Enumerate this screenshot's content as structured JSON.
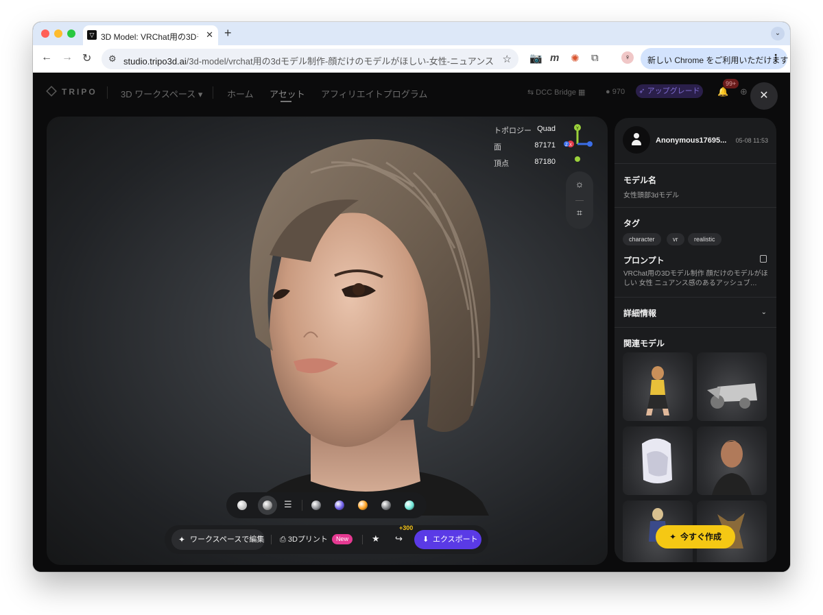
{
  "browser": {
    "tab_title": "3D Model: VRChat用の3Dモデ",
    "url_host": "studio.tripo3d.ai",
    "url_path": "/3d-model/vrchat用の3dモデル制作-顔だけのモデルがほしい-女性-ニュアンス感のあ…",
    "update_text": "新しい Chrome をご利用いただけます",
    "icons": [
      "back-icon",
      "forward-icon",
      "reload-icon",
      "site-settings-icon",
      "star-icon",
      "camera-icon",
      "extension-icon",
      "profile-icon",
      "menu-icon"
    ]
  },
  "nav": {
    "logo": "TRIPO",
    "workspace": "3D ワークスペース",
    "links": [
      "ホーム",
      "アセット",
      "アフィリエイトプログラム"
    ],
    "active_link": "アセット",
    "dcc_bridge": "DCC Bridge",
    "credits": "970",
    "upgrade": "アップグレード",
    "notif_count": "99+"
  },
  "viewer": {
    "stats": [
      {
        "label": "トポロジー",
        "value": "Quad"
      },
      {
        "label": "面",
        "value": "87171"
      },
      {
        "label": "頂点",
        "value": "87180"
      }
    ],
    "gizmo_labels": {
      "y": "Y",
      "x": "X",
      "z": "Z"
    }
  },
  "materials": {
    "colors": [
      "#cfcfcf",
      "#8e9096",
      "#6c5ce7",
      "#ff9f1c",
      "#7d7f83",
      "#6ee7d8"
    ]
  },
  "actions": {
    "edit": "ワークスペースで編集",
    "print": "3Dプリント",
    "new_badge": "New",
    "share_bonus": "+300",
    "export": "エクスポート"
  },
  "panel": {
    "user": "Anonymous17695...",
    "time": "05-08 11:53",
    "model_name_label": "モデル名",
    "model_name": "女性頭部3dモデル",
    "tags_label": "タグ",
    "tags": [
      "character",
      "vr",
      "realistic"
    ],
    "prompt_label": "プロンプト",
    "prompt": "VRChat用の3Dモデル制作 顔だけのモデルがほしい 女性 ニュアンス感のあるアッシュブ…",
    "details_label": "詳細情報",
    "related_label": "関連モデル",
    "create": "今すぐ作成"
  },
  "colors": {
    "accent_purple": "#5a3ae6",
    "accent_yellow": "#f5c814",
    "new_pink": "#e53991"
  }
}
